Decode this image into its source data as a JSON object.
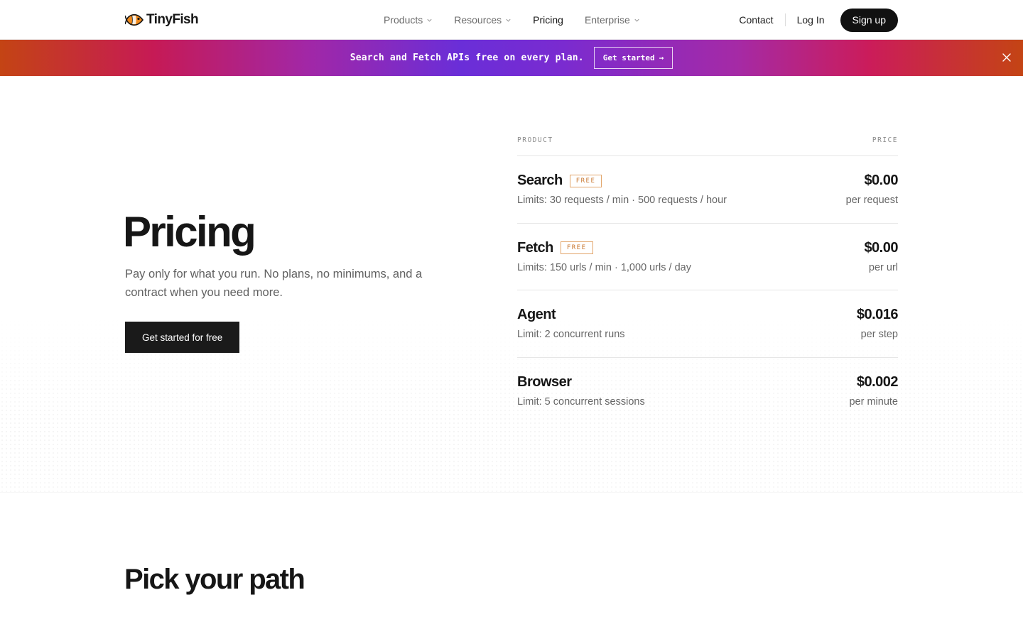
{
  "nav": {
    "brand": "TinyFish",
    "items": [
      {
        "label": "Products",
        "dropdown": true,
        "active": false
      },
      {
        "label": "Resources",
        "dropdown": true,
        "active": false
      },
      {
        "label": "Pricing",
        "dropdown": false,
        "active": true
      },
      {
        "label": "Enterprise",
        "dropdown": true,
        "active": false
      }
    ],
    "contact": "Contact",
    "login": "Log In",
    "signup": "Sign up"
  },
  "banner": {
    "text": "Search and Fetch APIs free on every plan.",
    "cta": "Get started",
    "cta_arrow": "→"
  },
  "hero": {
    "title": "Pricing",
    "subtitle": "Pay only for what you run. No plans, no minimums, and a contract when you need more.",
    "cta": "Get started for free"
  },
  "pricing": {
    "col_product": "PRODUCT",
    "col_price": "PRICE",
    "rows": [
      {
        "name": "Search",
        "badge": "FREE",
        "limits": "Limits: 30 requests / min · 500 requests / hour",
        "price": "$0.00",
        "unit": "per request"
      },
      {
        "name": "Fetch",
        "badge": "FREE",
        "limits": "Limits: 150 urls / min · 1,000 urls / day",
        "price": "$0.00",
        "unit": "per url"
      },
      {
        "name": "Agent",
        "badge": "",
        "limits": "Limit: 2 concurrent runs",
        "price": "$0.016",
        "unit": "per step"
      },
      {
        "name": "Browser",
        "badge": "",
        "limits": "Limit: 5 concurrent sessions",
        "price": "$0.002",
        "unit": "per minute"
      }
    ]
  },
  "section2": {
    "title": "Pick your path"
  },
  "colors": {
    "accent_orange": "#e2a56a",
    "banner_purple": "#6a2ed8",
    "banner_red": "#c61a55",
    "banner_orange": "#c44414",
    "dark": "#111111"
  },
  "icons": {
    "logo": "fish-icon",
    "dropdown": "chevron-down-icon",
    "close": "close-icon"
  }
}
